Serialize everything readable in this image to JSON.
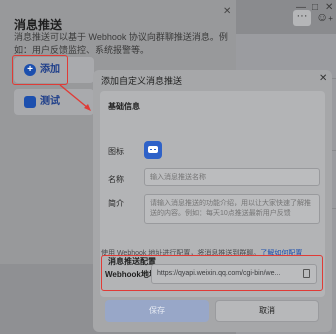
{
  "window": {
    "more_glyph": "···",
    "user_glyph": "+"
  },
  "panel": {
    "title": "消息推送",
    "description": "消息推送可以基于 Webhook 协议向群聊推送消息。例如：用户反馈监控、系统报警等。",
    "add_label": "添加",
    "test_label": "测试"
  },
  "dialog": {
    "title": "添加自定义消息推送",
    "basic_info": "基础信息",
    "icon_label": "图标",
    "name_label": "名称",
    "name_placeholder": "输入消息推送名称",
    "intro_label": "简介",
    "intro_placeholder": "请输入消息推送的功能介绍，用以让大家快速了解推送的内容。例如：每天10点推送最新用户反馈",
    "config_title": "消息推送配置",
    "config_desc": "使用 Webhook 地址进行配置，将消息推送到群聊。",
    "config_link": "了解如何配置",
    "webhook_label": "Webhook地址",
    "webhook_value": "https://qyapi.weixin.qq.com/cgi-bin/we...",
    "save_label": "保存",
    "cancel_label": "取消"
  },
  "colors": {
    "highlight": "#e03b36",
    "accent": "#1c4fae"
  }
}
